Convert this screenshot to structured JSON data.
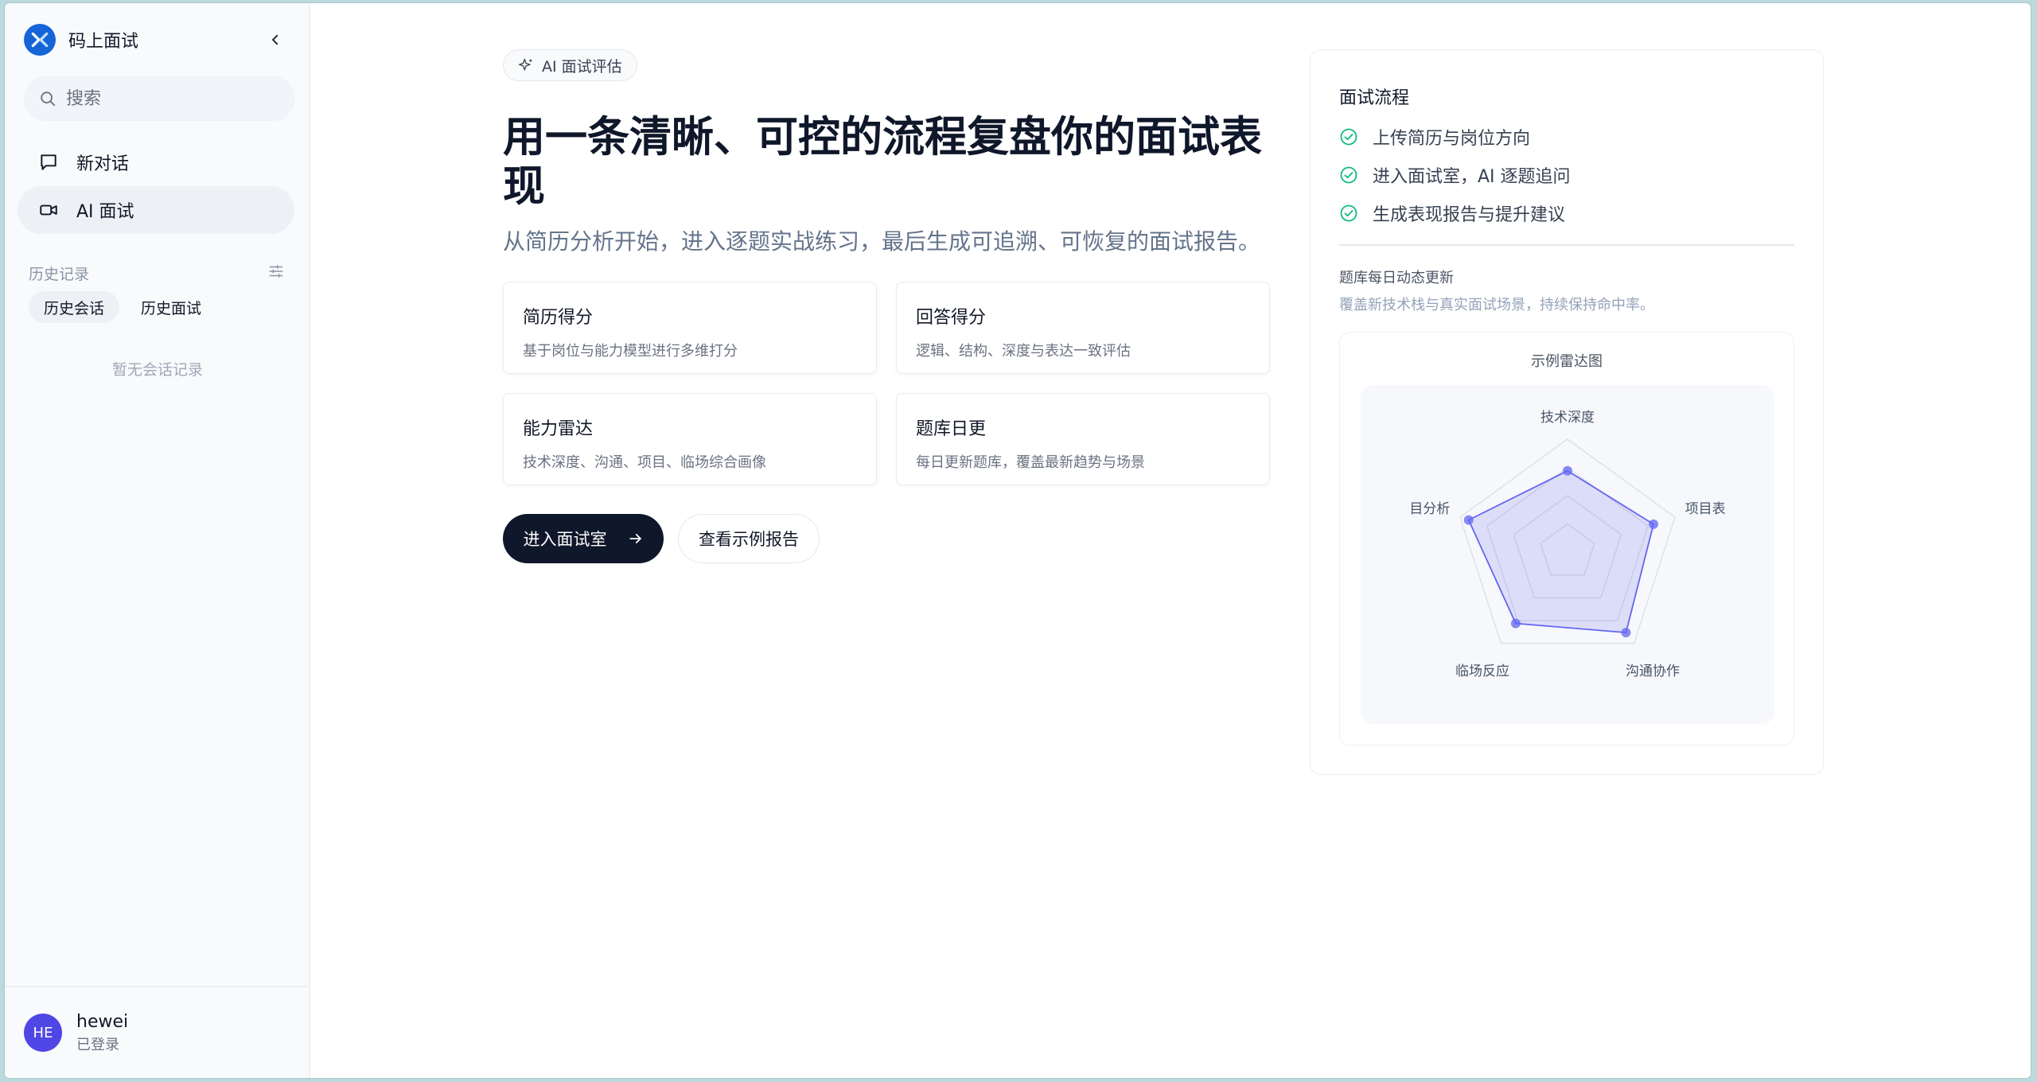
{
  "sidebar": {
    "brand": "码上面试",
    "search_placeholder": "搜索",
    "nav": [
      {
        "label": "新对话",
        "icon": "chat-icon"
      },
      {
        "label": "AI 面试",
        "icon": "video-icon"
      }
    ],
    "history_title": "历史记录",
    "history_tabs": [
      "历史会话",
      "历史面试"
    ],
    "empty_text": "暂无会话记录",
    "user": {
      "initials": "HE",
      "name": "hewei",
      "status": "已登录"
    }
  },
  "main": {
    "badge": "AI 面试评估",
    "title": "用一条清晰、可控的流程复盘你的面试表现",
    "subtitle": "从简历分析开始，进入逐题实战练习，最后生成可追溯、可恢复的面试报告。",
    "cards": [
      {
        "title": "简历得分",
        "desc": "基于岗位与能力模型进行多维打分"
      },
      {
        "title": "回答得分",
        "desc": "逻辑、结构、深度与表达一致评估"
      },
      {
        "title": "能力雷达",
        "desc": "技术深度、沟通、项目、临场综合画像"
      },
      {
        "title": "题库日更",
        "desc": "每日更新题库，覆盖最新趋势与场景"
      }
    ],
    "primary_button": "进入面试室",
    "secondary_button": "查看示例报告"
  },
  "panel": {
    "title": "面试流程",
    "steps": [
      "上传简历与岗位方向",
      "进入面试室，AI 逐题追问",
      "生成表现报告与提升建议"
    ],
    "bank_title": "题库每日动态更新",
    "bank_desc": "覆盖新技术栈与真实面试场景，持续保持命中率。",
    "radar_title": "示例雷达图"
  },
  "colors": {
    "accent": "#0f172a",
    "brand": "#1565d8",
    "check": "#10b981",
    "radar": "#6366f1"
  },
  "chart_data": {
    "type": "radar",
    "title": "示例雷达图",
    "axes": [
      "技术深度",
      "项目表",
      "沟通协作",
      "临场反应",
      "目分析"
    ],
    "max": 100,
    "values": [
      72,
      80,
      88,
      78,
      92
    ],
    "grid_levels": 4
  }
}
